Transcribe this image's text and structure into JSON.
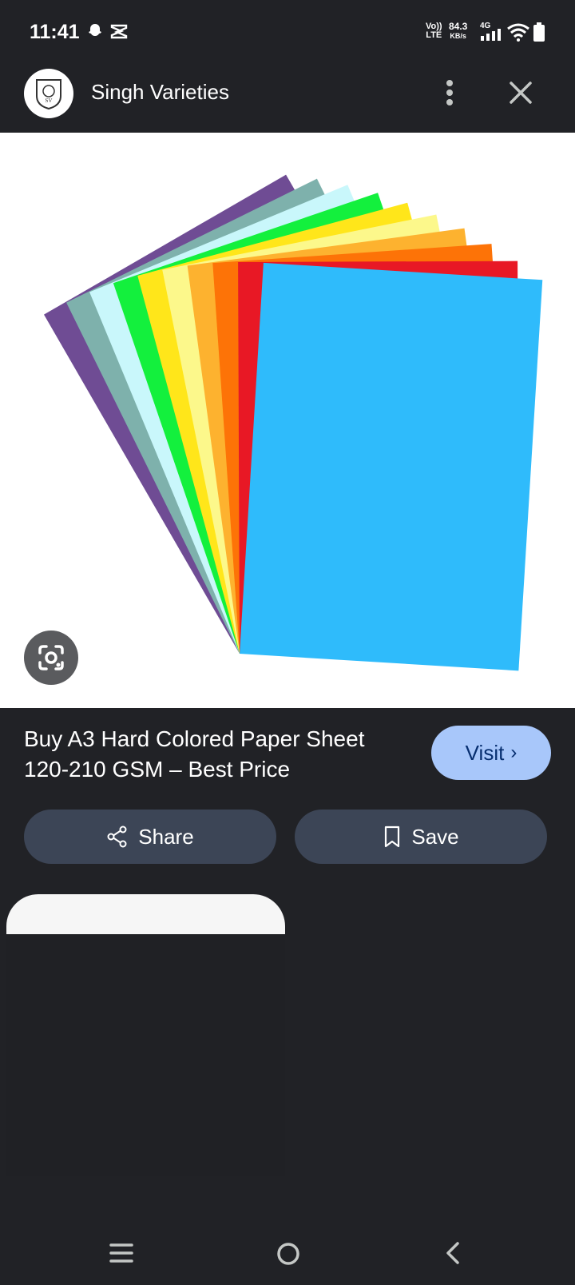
{
  "status_bar": {
    "time": "11:41",
    "volte_top": "Vo))",
    "volte_bottom": "LTE",
    "speed_value": "84.3",
    "speed_unit": "KB/s",
    "network": "4G",
    "icons": [
      "snapchat-icon",
      "capcut-icon",
      "signal-icon",
      "wifi-icon",
      "battery-icon"
    ]
  },
  "header": {
    "site_name": "Singh Varieties",
    "logo_text": "SV",
    "icons": [
      "more-vert-icon",
      "close-icon"
    ]
  },
  "image": {
    "description_icon": "google-lens-icon",
    "paper_colors": [
      "#6f4c94",
      "#7eb1ac",
      "#c9f7fb",
      "#13f03d",
      "#ffe61a",
      "#fcf88b",
      "#fdb22f",
      "#fd7307",
      "#e81825",
      "#2fbbfb"
    ]
  },
  "product": {
    "title": "Buy A3 Hard Colored Paper Sheet 120-210 GSM – Best Price",
    "visit_label": "Visit",
    "visit_chevron": "›"
  },
  "actions": {
    "share_label": "Share",
    "save_label": "Save"
  },
  "colors": {
    "background": "#212226",
    "button": "#3c4556",
    "visit_button": "#a8c7fa"
  }
}
